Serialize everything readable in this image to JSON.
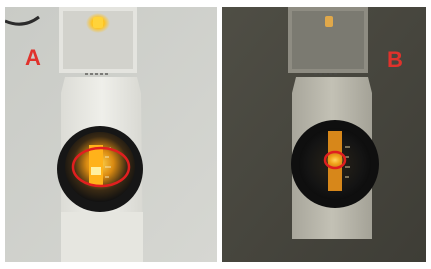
{
  "panels": [
    {
      "label": "A",
      "label_color": "#e0322c",
      "scene": "bright"
    },
    {
      "label": "B",
      "label_color": "#e0322c",
      "scene": "dim"
    }
  ],
  "colors": {
    "annotation": "#e01f1f",
    "glow": "#ffc21a"
  }
}
